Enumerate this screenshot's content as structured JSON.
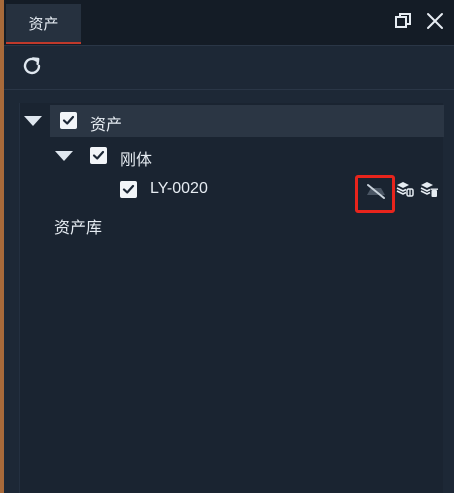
{
  "tab": {
    "title": "资产"
  },
  "window": {
    "restore_icon": "restore-window-icon",
    "close_icon": "close-icon"
  },
  "toolbar": {
    "refresh_icon": "refresh-icon"
  },
  "tree": {
    "root": {
      "label": "资产",
      "checked": true,
      "expanded": true
    },
    "group": {
      "label": "刚体",
      "checked": true,
      "expanded": true
    },
    "item": {
      "label": "LY-0020",
      "checked": true,
      "actions": [
        "visibility-off-icon",
        "layer-add-icon",
        "layer-delete-icon"
      ]
    },
    "library": {
      "label": "资产库"
    }
  },
  "colors": {
    "accent_tab_underline": "#c0392b",
    "highlight_box": "#e8241c",
    "panel_bg": "#1d2836"
  }
}
